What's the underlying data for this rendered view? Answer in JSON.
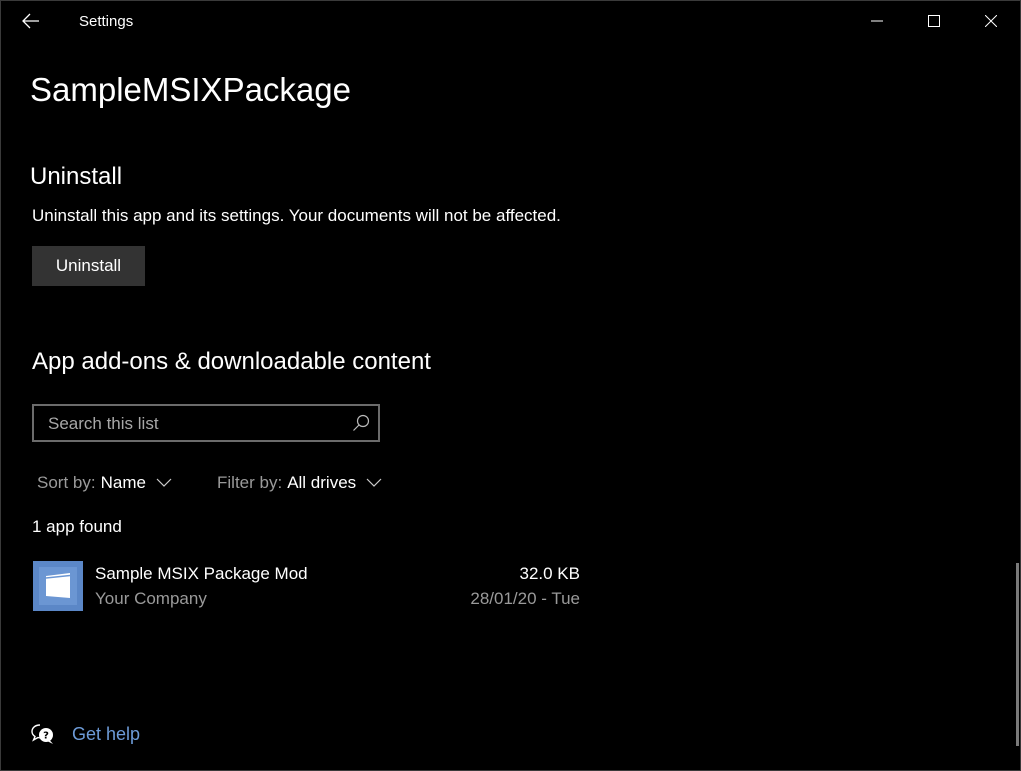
{
  "window": {
    "title": "Settings",
    "controls": {
      "minimize": "minimize",
      "maximize": "maximize",
      "close": "close"
    }
  },
  "page": {
    "title": "SampleMSIXPackage"
  },
  "uninstall": {
    "heading": "Uninstall",
    "description": "Uninstall this app and its settings. Your documents will not be affected.",
    "button_label": "Uninstall"
  },
  "addons": {
    "heading": "App add-ons & downloadable content",
    "search": {
      "placeholder": "Search this list",
      "value": ""
    },
    "sort": {
      "label": "Sort by:",
      "value": "Name"
    },
    "filter": {
      "label": "Filter by:",
      "value": "All drives"
    },
    "count_text": "1 app found",
    "apps": [
      {
        "name": "Sample MSIX Package Mod",
        "publisher": "Your Company",
        "size": "32.0 KB",
        "date": "28/01/20 - Tue"
      }
    ]
  },
  "help": {
    "link_label": "Get help"
  },
  "colors": {
    "background": "#000000",
    "button": "#333333",
    "link": "#6d9bd8",
    "app_tile": "#5b87c7",
    "secondary_text": "#9a9a9a"
  }
}
